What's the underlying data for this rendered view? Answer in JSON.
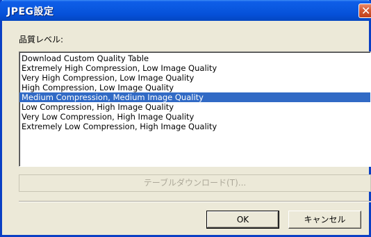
{
  "window": {
    "title": "JPEG設定",
    "close_symbol": "✕"
  },
  "quality": {
    "label": "品質レベル:",
    "items": [
      "Download Custom Quality Table",
      "Extremely High Compression, Low Image Quality",
      "Very High Compression, Low Image Quality",
      "High Compression, Low Image Quality",
      "Medium Compression, Medium Image Quality",
      "Low Compression, High Image Quality",
      "Very Low Compression, High Image Quality",
      "Extremely Low Compression, High Image Quality"
    ],
    "selected_index": 4
  },
  "buttons": {
    "download_label": "テーブルダウンロード(T)...",
    "ok_label": "OK",
    "cancel_label": "キャンセル"
  },
  "colors": {
    "titlebar": "#0a58e0",
    "selection": "#316ac5",
    "dialog_bg": "#ece9d8",
    "close_button": "#d45a33"
  },
  "icons": {
    "close": "close-icon"
  }
}
